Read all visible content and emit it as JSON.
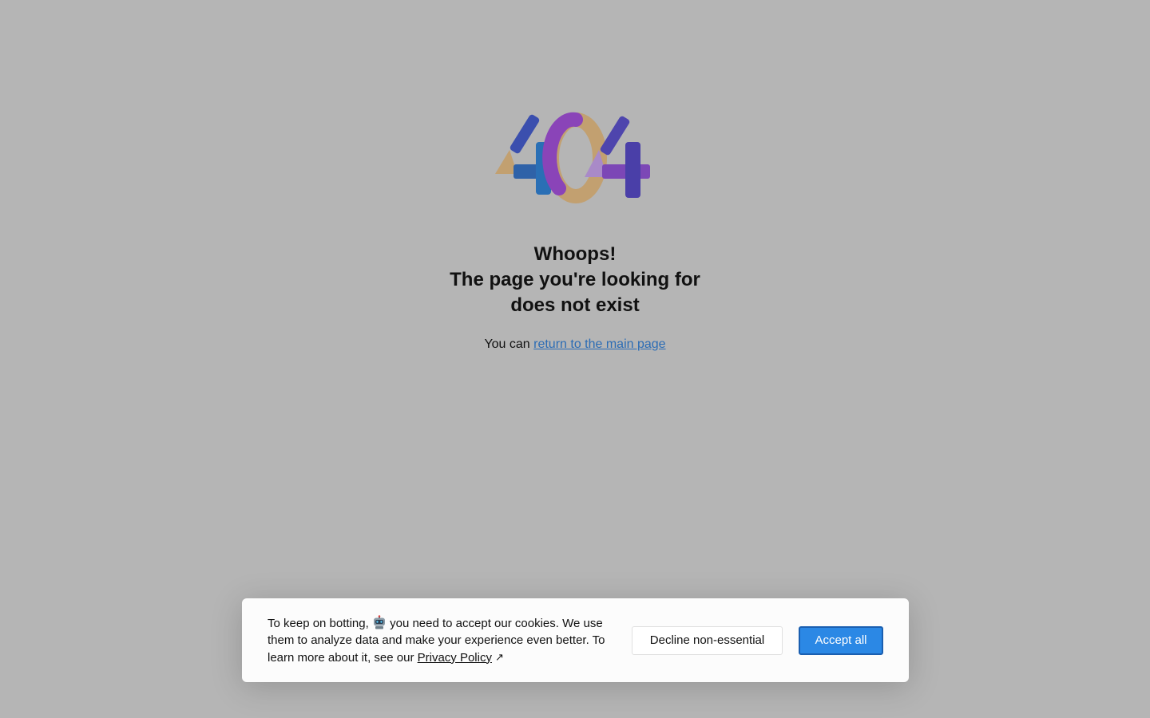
{
  "error_page": {
    "logo_text": "404",
    "headline_lines": [
      "Whoops!",
      "The page you're looking for",
      "does not exist"
    ],
    "return_prefix": "You can ",
    "return_link_label": "return to the main page"
  },
  "cookie_banner": {
    "text_before_icon": "To keep on botting, ",
    "icon": "robot-icon",
    "text_after_icon": " you need to accept our cookies. We use them to analyze data and make your experience even better. To learn more about it, see our ",
    "privacy_link_label": "Privacy Policy",
    "external_icon_glyph": "↗",
    "decline_label": "Decline non-essential",
    "accept_label": "Accept all"
  },
  "colors": {
    "background": "#b5b5b5",
    "link": "#2b6cb5",
    "accept_button": "#2b88e5",
    "logo_blue": "#3b4fae",
    "logo_purple": "#8a44b8",
    "logo_tan": "#c2a070",
    "logo_lilac": "#a98ac8"
  }
}
